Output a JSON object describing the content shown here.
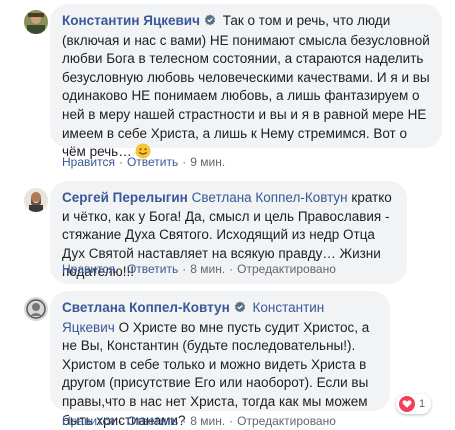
{
  "comments": [
    {
      "author": "Константин Яцкевич",
      "verified": true,
      "mention": "",
      "text": "Так о том и речь, что люди (включая и нас с вами) НЕ понимают смысла безусловной любви Бога в телесном состоянии, а стараются наделить безусловную любовь человеческими качествами. И я и вы одинаково НЕ понимаем любовь, а лишь фантазируем о ней в меру нашей страстности и вы и я в равной мере НЕ имеем в себе Христа, а лишь к Нему стремимся. Вот о чём речь…",
      "emoji": "smile-emoji",
      "actions": {
        "like": "Нравится",
        "reply": "Ответить",
        "time": "9 мин."
      }
    },
    {
      "author": "Сергей Перелыгин",
      "verified": false,
      "mention": "Светлана Коппел-Ковтун",
      "text": "кратко и чётко, как у Бога! Да, смысл и цель Православия - стяжание Духа Святого. Исходящий из недр Отца Дух Святой наставляет на всякую правду… Жизни подателю!!!",
      "actions": {
        "like": "Нравится",
        "reply": "Ответить",
        "time": "8 мин.",
        "edited": "Отредактировано"
      }
    },
    {
      "author": "Светлана Коппел-Ковтун",
      "verified": true,
      "mention": "Константин Яцкевич",
      "text": "О Христе во мне пусть судит Христос, а не Вы, Константин (будьте последовательны!). Христом в себе только и можно видеть Христа в другом (присутствие Его или наоборот). Если вы правы,что в нас нет Христа, тогда как мы можем быть христианами?",
      "actions": {
        "like": "Нравится",
        "reply": "Ответить",
        "time": "8 мин.",
        "edited": "Отредактировано"
      },
      "reactions": {
        "icon": "heart-icon",
        "count": "1"
      }
    }
  ],
  "colors": {
    "link": "#385898",
    "bubble": "#f2f3f5",
    "meta": "#606770",
    "love": "#f33e58"
  }
}
